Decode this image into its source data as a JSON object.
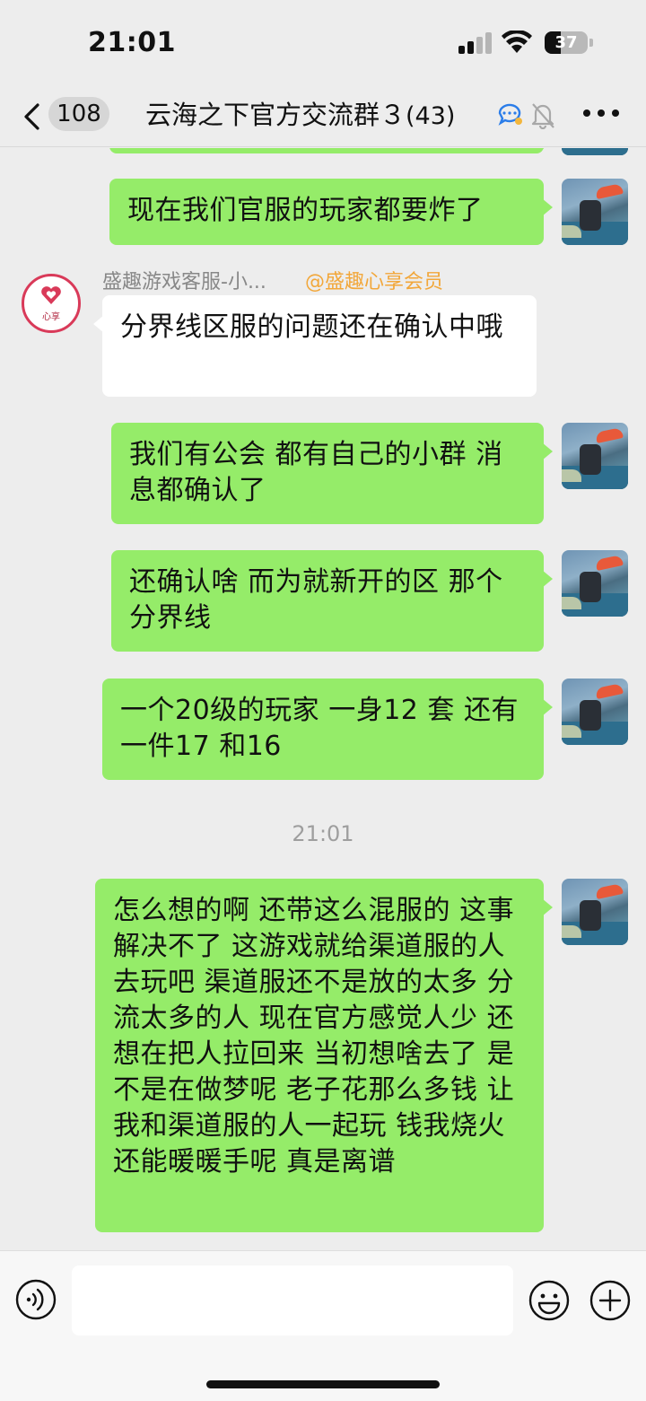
{
  "status_bar": {
    "time": "21:01",
    "battery_level": "37",
    "icons": [
      "signal-icon",
      "wifi-icon",
      "battery-icon"
    ]
  },
  "nav": {
    "back_icon": "chevron-left-icon",
    "unread_count": "108",
    "title": "云海之下官方交流群３",
    "member_count": "(43)",
    "icons": [
      "chat-bubbles-icon",
      "mute-bell-icon",
      "more-icon"
    ]
  },
  "messages": [
    {
      "sender": "self",
      "text": "现在我们官服的玩家都要炸了"
    },
    {
      "sender": "other",
      "name": "盛趣游戏客服-小...",
      "tag": "@盛趣心享会员",
      "avatar_text": "心享",
      "text": "分界线区服的问题还在确认中哦"
    },
    {
      "sender": "self",
      "text": "我们有公会  都有自己的小群  消息都确认了"
    },
    {
      "sender": "self",
      "text": "还确认啥   而为就新开的区 那个分界线"
    },
    {
      "sender": "self",
      "text": "一个20级的玩家 一身12 套 还有一件17 和16"
    },
    {
      "sender": "self",
      "text": "怎么想的啊  还带这么混服的  这事解决不了  这游戏就给渠道服的人去玩吧  渠道服还不是放的太多  分流太多的人  现在官方感觉人少  还想在把人拉回来  当初想啥去了  是不是在做梦呢  老子花那么多钱   让我和渠道服的人一起玩  钱我烧火还能暖暖手呢  真是离谱"
    }
  ],
  "timestamp": "21:01",
  "input_bar": {
    "placeholder": "",
    "icons": [
      "voice-icon",
      "emoji-icon",
      "plus-icon"
    ]
  },
  "colors": {
    "self_bubble": "#95ec69",
    "other_bubble": "#ffffff",
    "background": "#ededed",
    "tag": "#f2a73a"
  }
}
